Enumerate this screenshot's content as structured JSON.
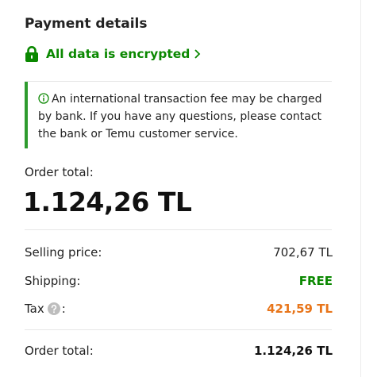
{
  "panel": {
    "title": "Payment details",
    "secure_link": "All data is encrypted",
    "notice": "An international transaction fee may be charged by bank. If you have any questions, please contact the bank or Temu customer service.",
    "order_total_label": "Order total:",
    "order_total_value": "1.124,26 TL"
  },
  "summary": {
    "selling_label": "Selling price:",
    "selling_value": "702,67 TL",
    "shipping_label": "Shipping:",
    "shipping_value": "FREE",
    "tax_label": "Tax",
    "tax_colon": ":",
    "tax_value": "421,59 TL",
    "total_label": "Order total:",
    "total_value": "1.124,26 TL"
  },
  "colors": {
    "secure_green": "#0a8800",
    "notice_border": "#2e9b2e",
    "tax_orange": "#e8751a"
  },
  "icons": {
    "secure": "lock-icon",
    "secure_chevron": "chevron-right-icon",
    "notice": "info-circle-icon",
    "tax_help": "question-circle-icon"
  }
}
